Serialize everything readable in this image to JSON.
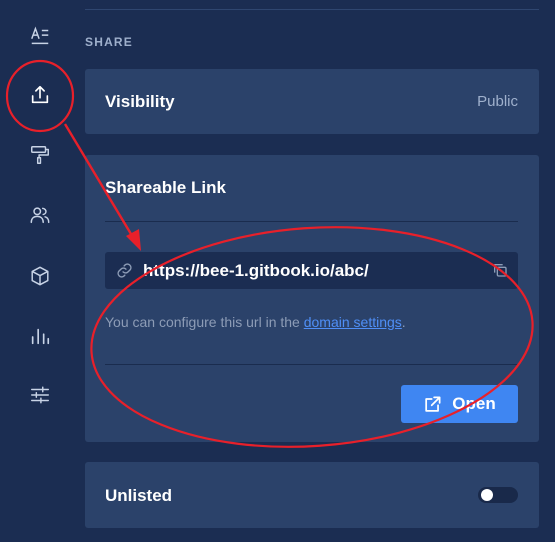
{
  "sidebar": {
    "icons": [
      {
        "name": "text-format-icon"
      },
      {
        "name": "share-upload-icon",
        "active": true
      },
      {
        "name": "paint-roller-icon"
      },
      {
        "name": "users-icon"
      },
      {
        "name": "cube-icon"
      },
      {
        "name": "bar-chart-icon"
      },
      {
        "name": "sliders-icon"
      }
    ]
  },
  "section": {
    "title": "SHARE"
  },
  "visibility": {
    "label": "Visibility",
    "value": "Public"
  },
  "share": {
    "title": "Shareable Link",
    "url": "https://bee-1.gitbook.io/abc/",
    "helper_prefix": "You can configure this url in the ",
    "helper_link": "domain settings",
    "helper_suffix": ".",
    "open_label": "Open"
  },
  "unlisted": {
    "label": "Unlisted",
    "enabled": false
  },
  "colors": {
    "background": "#1b2d52",
    "card": "#2b426a",
    "accent": "#3f86f2",
    "link": "#4f8ff7",
    "annotation": "#e8202a"
  }
}
